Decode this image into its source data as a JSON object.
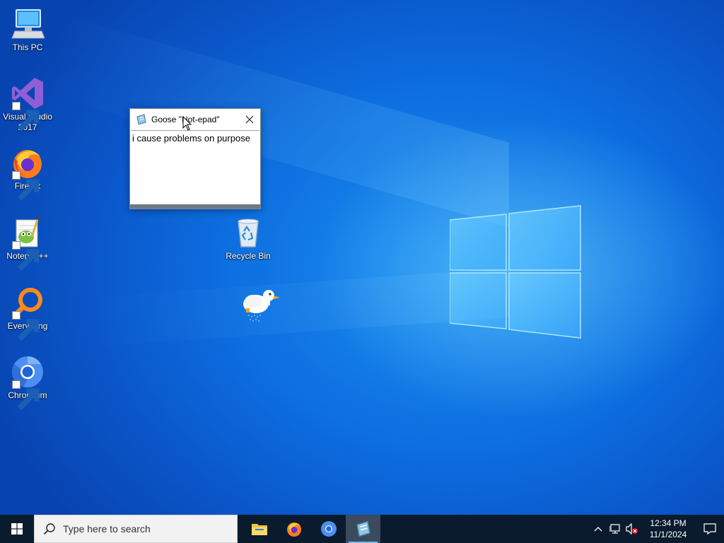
{
  "desktop": {
    "icons": [
      {
        "label": "This PC",
        "icon": "computer-icon",
        "shortcut": false
      },
      {
        "label": "Visual Studio 2017",
        "icon": "visual-studio-icon",
        "shortcut": true
      },
      {
        "label": "Firefox",
        "icon": "firefox-icon",
        "shortcut": true
      },
      {
        "label": "Notepad++",
        "icon": "notepad-plus-plus-icon",
        "shortcut": true
      },
      {
        "label": "Everything",
        "icon": "everything-search-icon",
        "shortcut": true
      },
      {
        "label": "Chromium",
        "icon": "chromium-icon",
        "shortcut": true
      },
      {
        "label": "Recycle Bin",
        "icon": "recycle-bin-icon",
        "shortcut": false
      }
    ]
  },
  "notepad": {
    "title": "Goose \"Not-epad\"",
    "content": "i cause problems on purpose",
    "close_icon": "close-icon"
  },
  "taskbar": {
    "search_placeholder": "Type here to search",
    "apps": [
      {
        "name": "File Explorer",
        "icon": "folder-icon",
        "running": false
      },
      {
        "name": "Firefox",
        "icon": "firefox-icon",
        "running": false
      },
      {
        "name": "Chromium",
        "icon": "chromium-icon",
        "running": false
      },
      {
        "name": "Notepad",
        "icon": "notepad-icon",
        "running": true,
        "active": true
      }
    ],
    "tray": {
      "time": "12:34 PM",
      "date": "11/1/2024",
      "icons": [
        "chevron-up-icon",
        "network-icon",
        "volume-muted-icon"
      ]
    }
  },
  "colors": {
    "desktop_blue": "#0d6fe0",
    "taskbar_bg": "#0b1b2e",
    "active_indicator": "#76b9ed"
  }
}
